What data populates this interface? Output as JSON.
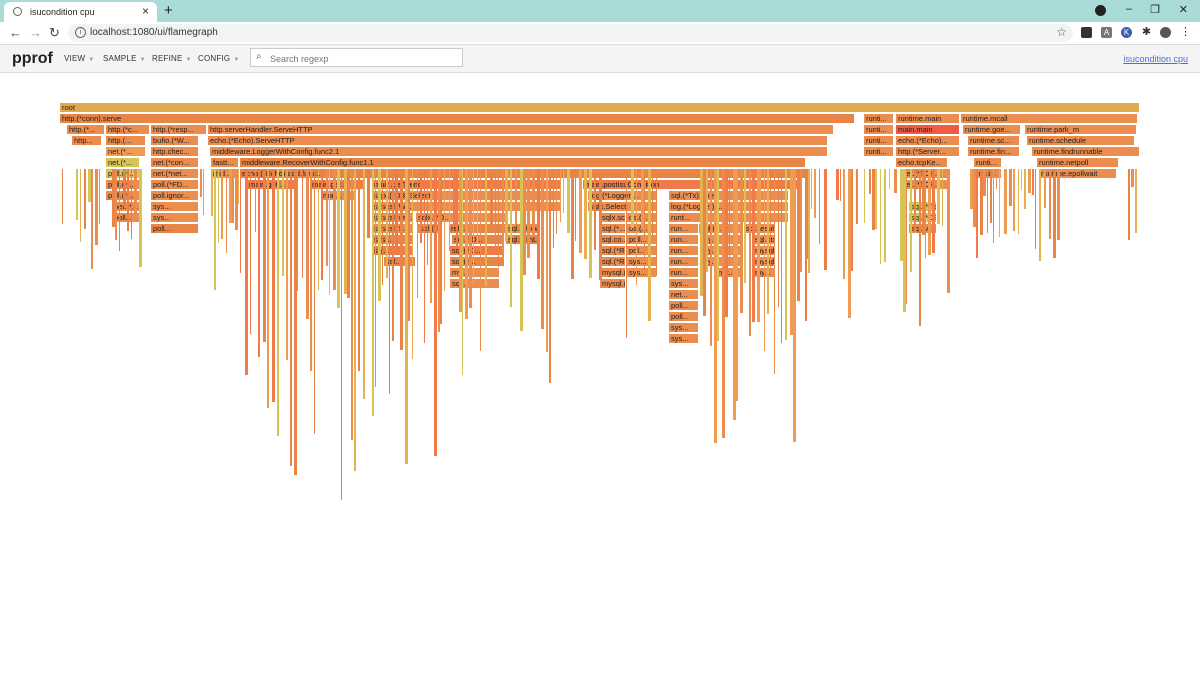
{
  "browser": {
    "tab_title": "isucondition cpu",
    "url": "localhost:1080/ui/flamegraph"
  },
  "toolbar": {
    "brand": "pprof",
    "menus": [
      "VIEW",
      "SAMPLE",
      "REFINE",
      "CONFIG"
    ],
    "search_placeholder": "Search regexp",
    "profile_link": "isucondition cpu"
  },
  "frames": [
    {
      "label": "root"
    },
    {
      "label": "http.(*conn).serve"
    },
    {
      "label": "runti..."
    },
    {
      "label": "runtime.main"
    },
    {
      "label": "runtime.mcall"
    },
    {
      "label": "http.(*..."
    },
    {
      "label": "http.(*c..."
    },
    {
      "label": "http.(*resp..."
    },
    {
      "label": "http.serverHandler.ServeHTTP"
    },
    {
      "label": "runti..."
    },
    {
      "label": "main.main"
    },
    {
      "label": "runtime.goe..."
    },
    {
      "label": "runtime.park_m"
    },
    {
      "label": "http..."
    },
    {
      "label": "http.(..."
    },
    {
      "label": "bufio.(*W..."
    },
    {
      "label": "echo.(*Echo).ServeHTTP"
    },
    {
      "label": "runti..."
    },
    {
      "label": "echo.(*Echo)..."
    },
    {
      "label": "runtime.sc..."
    },
    {
      "label": "runtime.schedule"
    },
    {
      "label": "net.(*..."
    },
    {
      "label": "http.chec..."
    },
    {
      "label": "middleware.LoggerWithConfig.func2.1"
    },
    {
      "label": "runti..."
    },
    {
      "label": "http.(*Server..."
    },
    {
      "label": "runtime.fin..."
    },
    {
      "label": "runtime.findrunnable"
    },
    {
      "label": "net.(*..."
    },
    {
      "label": "net.(*con..."
    },
    {
      "label": "fastt..."
    },
    {
      "label": "middleware.RecoverWithConfig.func1.1"
    },
    {
      "label": "echo.tcpKe..."
    },
    {
      "label": "runti..."
    },
    {
      "label": "runtime.netpoll"
    },
    {
      "label": "poll.(*..."
    },
    {
      "label": "net.(*net..."
    },
    {
      "label": "mid..."
    },
    {
      "label": "echo.(*Echo).add.func1"
    },
    {
      "label": "net.(*TCP..."
    },
    {
      "label": "runti..."
    },
    {
      "label": "runtime.epollwait"
    },
    {
      "label": "poll.(*..."
    },
    {
      "label": "poll.(*FD..."
    },
    {
      "label": "main.get..."
    },
    {
      "label": "main.getI..."
    },
    {
      "label": "main.getTrend"
    },
    {
      "label": "main.postIsuCondition"
    },
    {
      "label": "net.(*TCP..."
    },
    {
      "label": "poll.(*..."
    },
    {
      "label": "poll.ignor..."
    },
    {
      "label": "mai..."
    },
    {
      "label": "sqlx.(*DB).Select"
    },
    {
      "label": "log.(*Logger)..."
    },
    {
      "label": "sql.(*Tx).Exec"
    },
    {
      "label": "net.(*..."
    },
    {
      "label": "sys..."
    },
    {
      "label": "syscall.W..."
    },
    {
      "label": "sqlx.Select"
    },
    {
      "label": "log.(*Logger).I..."
    },
    {
      "label": "sql.(*Tx).ExecContext"
    },
    {
      "label": "poll..."
    },
    {
      "label": "sys..."
    },
    {
      "label": "syscall.wr..."
    },
    {
      "label": "sqlx.(*D..."
    },
    {
      "label": "sqlx.scanAll"
    },
    {
      "label": "os.(..."
    },
    {
      "label": "runt..."
    },
    {
      "label": "sql.(*DB).execDC"
    },
    {
      "label": "poll..."
    },
    {
      "label": "syscall.S..."
    },
    {
      "label": "sql.(*D..."
    },
    {
      "label": "refl..."
    },
    {
      "label": "sql.(*Rows)..."
    },
    {
      "label": "sql.(*..."
    },
    {
      "label": "os.(..."
    },
    {
      "label": "run..."
    },
    {
      "label": "sql.(..."
    },
    {
      "label": "sql.resul..."
    },
    {
      "label": "sql.wi..."
    },
    {
      "label": "sys..."
    },
    {
      "label": "sql.(*D..."
    },
    {
      "label": "sql.withLock"
    },
    {
      "label": "sql.co..."
    },
    {
      "label": "poll..."
    },
    {
      "label": "run..."
    },
    {
      "label": "my..."
    },
    {
      "label": "sql.ctxD..."
    },
    {
      "label": "sql..."
    },
    {
      "label": "sql.(*D..."
    },
    {
      "label": "sql.(*Row..."
    },
    {
      "label": "pol..."
    },
    {
      "label": "run..."
    },
    {
      "label": "my..."
    },
    {
      "label": "mysql.(..."
    },
    {
      "label": "sql..."
    },
    {
      "label": "sql.(*..."
    },
    {
      "label": "sql.(*Row..."
    },
    {
      "label": "sys..."
    },
    {
      "label": "run..."
    },
    {
      "label": "my..."
    },
    {
      "label": "mysql.(..."
    },
    {
      "label": "my..."
    },
    {
      "label": "mysql.(*..."
    },
    {
      "label": "sys..."
    },
    {
      "label": "run..."
    },
    {
      "label": "net..."
    },
    {
      "label": "my..."
    },
    {
      "label": "sql..."
    },
    {
      "label": "mysql.(*..."
    },
    {
      "label": "sys..."
    },
    {
      "label": "net..."
    },
    {
      "label": "poll..."
    },
    {
      "label": "poll..."
    },
    {
      "label": "sys..."
    },
    {
      "label": "sys..."
    },
    {
      "label": "sys..."
    }
  ]
}
